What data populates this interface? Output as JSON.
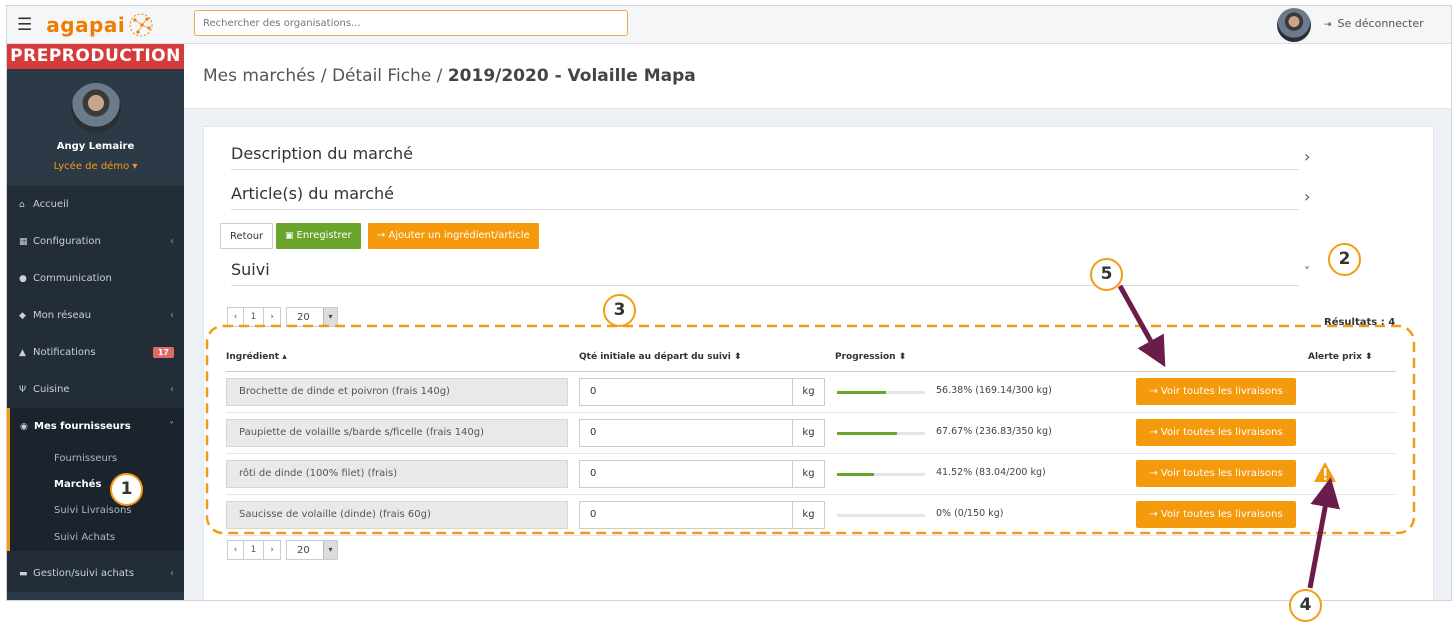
{
  "brand": {
    "logo_text": "agapai",
    "env_label": "PREPRODUCTION"
  },
  "user": {
    "name": "Angy Lemaire",
    "school": "Lycée de démo ▾"
  },
  "topbar": {
    "search_placeholder": "Rechercher des organisations...",
    "logout_label": "Se déconnecter"
  },
  "nav": {
    "items": [
      {
        "label": "Accueil",
        "icon": "home-icon",
        "glyph": "⌂"
      },
      {
        "label": "Configuration",
        "icon": "bank-icon",
        "glyph": "▦",
        "chevron": "‹"
      },
      {
        "label": "Communication",
        "icon": "chat-icon",
        "glyph": "●"
      },
      {
        "label": "Mon réseau",
        "icon": "users-icon",
        "glyph": "◆",
        "chevron": "‹"
      },
      {
        "label": "Notifications",
        "icon": "bell-icon",
        "glyph": "▲",
        "badge": "17"
      },
      {
        "label": "Cuisine",
        "icon": "cutlery-icon",
        "glyph": "Ψ",
        "chevron": "‹"
      },
      {
        "label": "Mes fournisseurs",
        "icon": "eye-icon",
        "glyph": "◉",
        "chevron": "˅"
      }
    ],
    "sub_items": [
      "Fournisseurs",
      "Marchés",
      "Suivi Livraisons",
      "Suivi Achats"
    ],
    "bottom_item": {
      "label": "Gestion/suivi achats",
      "icon": "cart-icon",
      "glyph": "▬",
      "chevron": "‹"
    }
  },
  "breadcrumb": {
    "path": "Mes marchés / Détail Fiche / ",
    "current": "2019/2020 - Volaille Mapa"
  },
  "sections": {
    "description": "Description du marché",
    "articles": "Article(s) du marché",
    "suivi": "Suivi"
  },
  "buttons": {
    "retour": "Retour",
    "save": "Enregistrer",
    "add": "→ Ajouter un ingrédient/article"
  },
  "pager": {
    "prev": "‹",
    "page": "1",
    "next": "›",
    "per_page": "20"
  },
  "results": "Résultats : 4",
  "table": {
    "headers": {
      "ingredient": "Ingrédient ▴",
      "qty": "Qté initiale au départ du suivi ⬍",
      "progress": "Progression ⬍",
      "alert": "Alerte prix ⬍"
    },
    "action_label": "→ Voir toutes les livraisons",
    "rows": [
      {
        "ingredient": "Brochette de dinde et poivron (frais 140g)",
        "qty": "0",
        "unit": "kg",
        "progress": 0.5638,
        "progress_text": "56.38% (169.14/300 kg)",
        "alert": false
      },
      {
        "ingredient": "Paupiette de volaille s/barde s/ficelle (frais 140g)",
        "qty": "0",
        "unit": "kg",
        "progress": 0.6767,
        "progress_text": "67.67% (236.83/350 kg)",
        "alert": false
      },
      {
        "ingredient": "rôti de dinde (100% filet) (frais)",
        "qty": "0",
        "unit": "kg",
        "progress": 0.4152,
        "progress_text": "41.52% (83.04/200 kg)",
        "alert": true
      },
      {
        "ingredient": "Saucisse de volaille (dinde) (frais 60g)",
        "qty": "0",
        "unit": "kg",
        "progress": 0,
        "progress_text": "0% (0/150 kg)",
        "alert": false
      }
    ]
  },
  "annotations": [
    "1",
    "2",
    "3",
    "4",
    "5"
  ],
  "colors": {
    "accent": "#f49a0c",
    "success": "#6aa42b",
    "danger": "#d63b3b",
    "sidebar": "#2c3a47",
    "arrow": "#6b1d4a"
  }
}
